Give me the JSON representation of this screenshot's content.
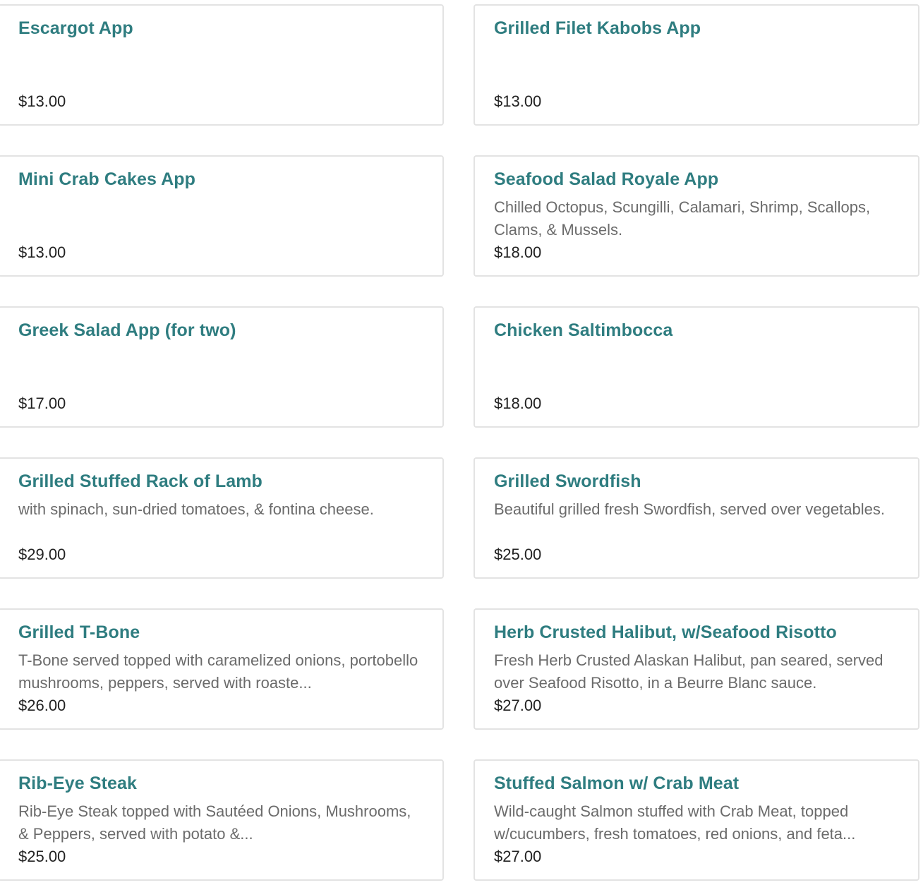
{
  "menu_items": [
    {
      "name": "Escargot App",
      "description": "",
      "price": "$13.00"
    },
    {
      "name": "Grilled Filet Kabobs App",
      "description": "",
      "price": "$13.00"
    },
    {
      "name": "Mini Crab Cakes App",
      "description": "",
      "price": "$13.00"
    },
    {
      "name": "Seafood Salad Royale App",
      "description": "Chilled Octopus, Scungilli, Calamari, Shrimp, Scallops, Clams, & Mussels.",
      "price": "$18.00"
    },
    {
      "name": "Greek Salad App (for two)",
      "description": "",
      "price": "$17.00"
    },
    {
      "name": "Chicken Saltimbocca",
      "description": "",
      "price": "$18.00"
    },
    {
      "name": "Grilled Stuffed Rack of Lamb",
      "description": "with spinach, sun-dried tomatoes, & fontina cheese.",
      "price": "$29.00"
    },
    {
      "name": "Grilled Swordfish",
      "description": "Beautiful grilled fresh Swordfish, served over vegetables.",
      "price": "$25.00"
    },
    {
      "name": "Grilled T-Bone",
      "description": "T-Bone served topped with caramelized onions, portobello mushrooms, peppers, served with roaste...",
      "price": "$26.00"
    },
    {
      "name": "Herb Crusted Halibut, w/Seafood Risotto",
      "description": "Fresh Herb Crusted Alaskan Halibut, pan seared, served over Seafood Risotto, in a Beurre Blanc sauce.",
      "price": "$27.00"
    },
    {
      "name": "Rib-Eye Steak",
      "description": "Rib-Eye Steak topped with Sautéed Onions, Mushrooms, & Peppers, served with potato &...",
      "price": "$25.00"
    },
    {
      "name": "Stuffed Salmon w/ Crab Meat",
      "description": "Wild-caught Salmon stuffed with Crab Meat, topped w/cucumbers, fresh tomatoes, red onions, and feta...",
      "price": "$27.00"
    }
  ],
  "colors": {
    "title": "#2f7d80",
    "description": "#6b6b6b",
    "price": "#222222",
    "border": "#e3e3e3"
  }
}
